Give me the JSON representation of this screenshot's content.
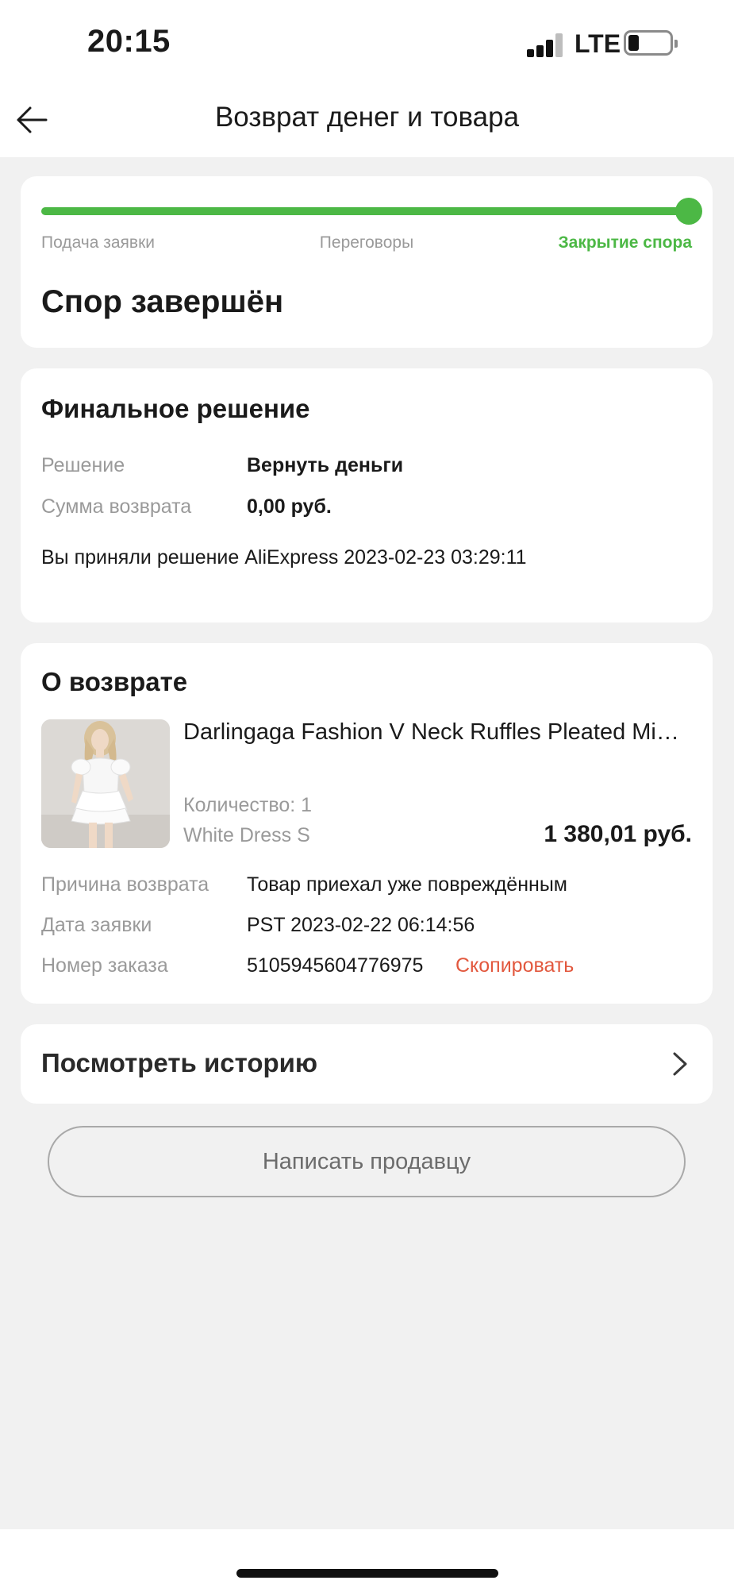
{
  "status_bar": {
    "time": "20:15",
    "network": "LTE",
    "battery_level": 0.2
  },
  "header": {
    "title": "Возврат денег и товара",
    "back_icon": "arrow-left-icon"
  },
  "progress": {
    "steps": [
      "Подача заявки",
      "Переговоры",
      "Закрытие спора"
    ],
    "current_step": 3,
    "fraction": 1.0,
    "status_title": "Спор завершён",
    "accent_color": "#4cb845"
  },
  "final_decision": {
    "title": "Финальное решение",
    "rows": [
      {
        "label": "Решение",
        "value": "Вернуть деньги"
      },
      {
        "label": "Сумма возврата",
        "value": "0,00 руб."
      }
    ],
    "note": "Вы приняли решение AliExpress 2023-02-23 03:29:11"
  },
  "return_info": {
    "title": "О возврате",
    "product": {
      "title": "Darlingaga Fashion V Neck Ruffles Pleated Mini Dress",
      "quantity": "Количество: 1",
      "variant": "White Dress S",
      "price": "1 380,01 руб."
    },
    "rows": [
      {
        "label": "Причина возврата",
        "value": "Товар приехал уже повреждённым"
      },
      {
        "label": "Дата заявки",
        "value": "PST 2023-02-22 06:14:56"
      },
      {
        "label": "Номер заказа",
        "value": "5105945604776975"
      }
    ],
    "copy_label": "Скопировать",
    "copy_color": "#e2583e"
  },
  "history": {
    "label": "Посмотреть историю",
    "icon": "chevron-right-icon"
  },
  "contact_seller": {
    "label": "Написать продавцу"
  }
}
